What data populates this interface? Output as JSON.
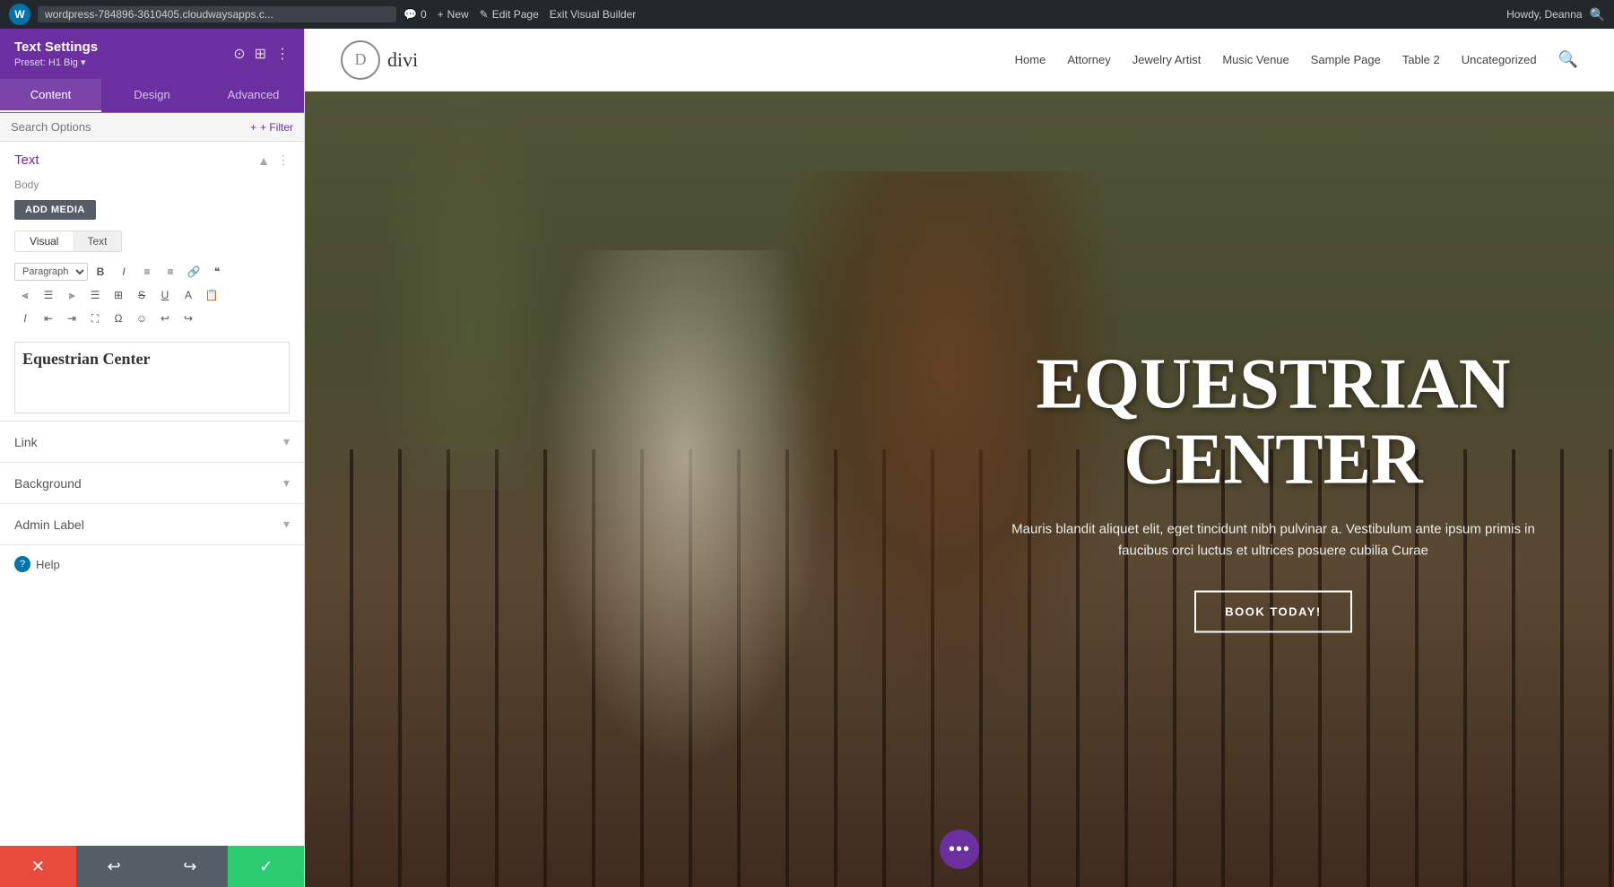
{
  "admin_bar": {
    "wp_logo": "W",
    "site_url": "wordpress-784896-3610405.cloudwaysapps.c...",
    "comments_count": "0",
    "new_label": "New",
    "edit_page_label": "Edit Page",
    "exit_builder_label": "Exit Visual Builder",
    "howdy_label": "Howdy, Deanna",
    "comment_icon": "💬"
  },
  "panel": {
    "title": "Text Settings",
    "preset_label": "Preset: H1 Big",
    "preset_dropdown": "▾",
    "tabs": [
      {
        "id": "content",
        "label": "Content",
        "active": true
      },
      {
        "id": "design",
        "label": "Design",
        "active": false
      },
      {
        "id": "advanced",
        "label": "Advanced",
        "active": false
      }
    ],
    "search_placeholder": "Search Options",
    "filter_label": "+ Filter",
    "text_section": {
      "title": "Text",
      "body_label": "Body",
      "add_media_label": "ADD MEDIA",
      "editor_tabs": [
        {
          "id": "visual",
          "label": "Visual",
          "active": true
        },
        {
          "id": "text",
          "label": "Text",
          "active": false
        }
      ],
      "toolbar": {
        "paragraph_select": "Paragraph",
        "bold": "B",
        "italic": "I",
        "ul": "≡",
        "ol": "≡",
        "link": "🔗",
        "quote": "❝",
        "align_left": "⫸",
        "align_center": "≡",
        "align_right": "≡",
        "justify": "≡",
        "table": "⊞",
        "strikethrough": "S",
        "underline": "U",
        "text_color": "A",
        "paste": "📋",
        "italic2": "I",
        "indent_left": "≡",
        "indent_right": "≡",
        "fullscreen": "⛶",
        "omega": "Ω",
        "emoji": "☺",
        "undo_icon": "↩",
        "redo_icon": "↪"
      },
      "content_text": "Equestrian Center"
    },
    "sections": [
      {
        "id": "link",
        "label": "Link"
      },
      {
        "id": "background",
        "label": "Background"
      },
      {
        "id": "admin_label",
        "label": "Admin Label"
      }
    ],
    "help_label": "Help"
  },
  "bottom_bar": {
    "cancel_icon": "✕",
    "undo_icon": "↩",
    "redo_icon": "↪",
    "save_icon": "✓"
  },
  "site": {
    "logo_letter": "D",
    "logo_text": "divi",
    "nav_items": [
      {
        "label": "Home"
      },
      {
        "label": "Attorney"
      },
      {
        "label": "Jewelry Artist"
      },
      {
        "label": "Music Venue"
      },
      {
        "label": "Sample Page"
      },
      {
        "label": "Table 2"
      },
      {
        "label": "Uncategorized"
      }
    ]
  },
  "hero": {
    "title_line1": "EQUESTRIAN",
    "title_line2": "CENTER",
    "subtitle": "Mauris blandit aliquet elit, eget tincidunt nibh pulvinar a. Vestibulum ante ipsum primis in faucibus orci luctus et ultrices posuere cubilia Curae",
    "button_label": "BOOK TODAY!",
    "dots": "•••"
  }
}
